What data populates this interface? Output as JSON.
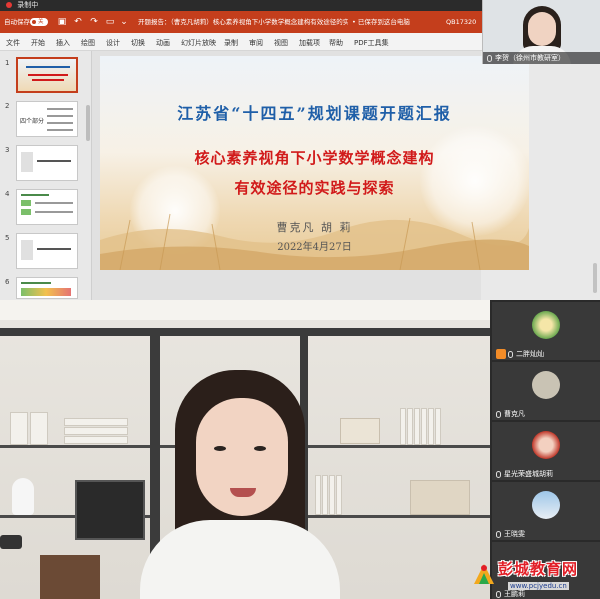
{
  "recording": {
    "label": "录制中"
  },
  "titlebar": {
    "autosave_label": "自动保存",
    "autosave_state": "关",
    "document_title": "开题报告：（曹克凡胡莉）核心素养视角下小学数学概念建构有效途径的实践与探...",
    "saved_status": "• 已保存到这台电脑",
    "user_id": "QB17320"
  },
  "ribbon": {
    "tabs": [
      "文件",
      "开始",
      "插入",
      "绘图",
      "设计",
      "切换",
      "动画",
      "幻灯片放映",
      "录制",
      "审阅",
      "视图",
      "加载项",
      "帮助",
      "PDF工具集"
    ]
  },
  "thumbnails": [
    {
      "number": "1"
    },
    {
      "number": "2",
      "caption": "四个部分"
    },
    {
      "number": "3"
    },
    {
      "number": "4"
    },
    {
      "number": "5"
    },
    {
      "number": "6"
    }
  ],
  "slide": {
    "title": "江苏省“十四五”规划课题开题汇报",
    "subtitle_line1": "核心素养视角下小学数学概念建构",
    "subtitle_line2": "有效途径的实践与探索",
    "authors": "曹克凡  胡 莉",
    "date": "2022年4月27日"
  },
  "presenter": {
    "name": "李贺（徐州市教研室）"
  },
  "participants": [
    {
      "name": "二胖灿灿",
      "is_host": true
    },
    {
      "name": "曹克凡",
      "is_host": false
    },
    {
      "name": "星光荣盛城胡莉",
      "is_host": false
    },
    {
      "name": "王晓雯",
      "is_host": false
    },
    {
      "name": "王鹏莉",
      "is_host": false
    }
  ],
  "watermark": {
    "brand": "彭城教育网",
    "url": "www.pcjyedu.cn"
  },
  "colors": {
    "ppt_accent": "#c43e1c",
    "slide_title_blue": "#1f5fa8",
    "slide_title_red": "#d11a1a"
  }
}
